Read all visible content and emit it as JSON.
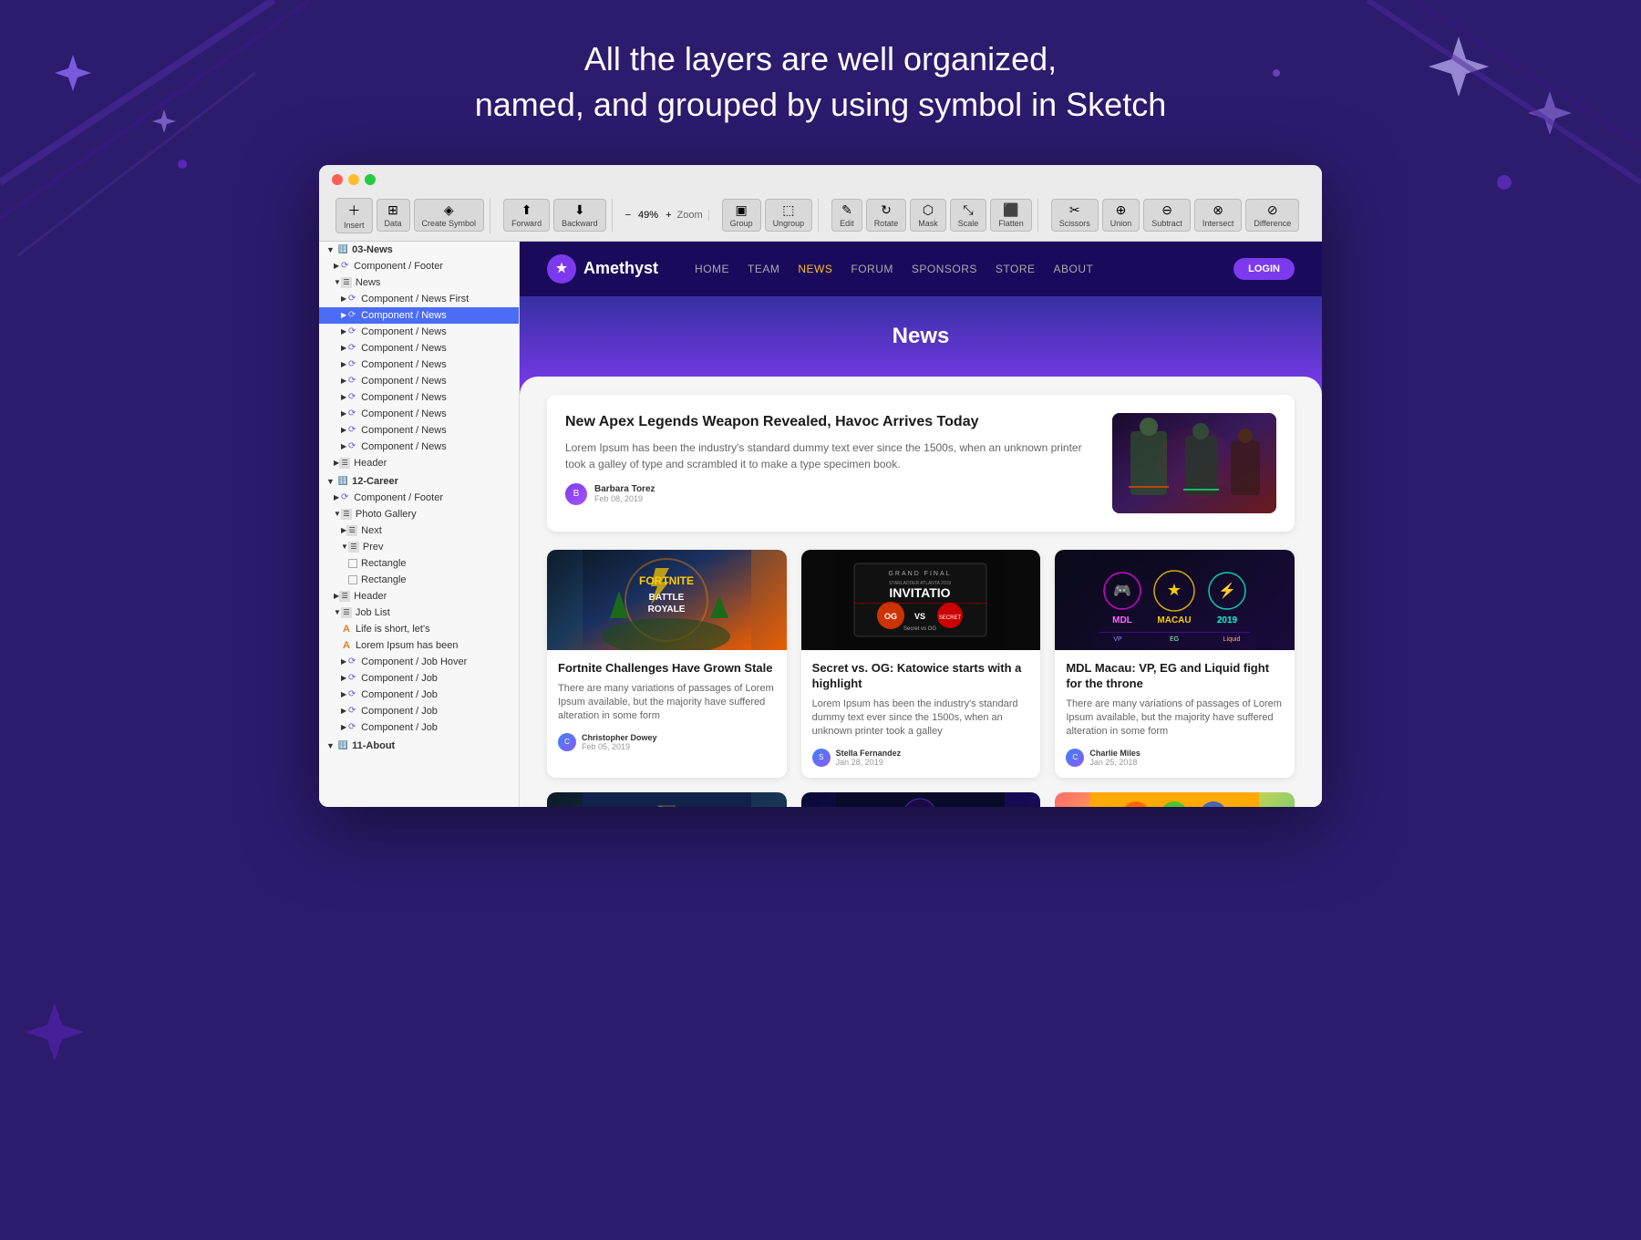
{
  "background": {
    "color": "#2d1b6e"
  },
  "hero": {
    "line1": "All the layers are well organized,",
    "line2": "named, and grouped by using symbol in Sketch"
  },
  "toolbar": {
    "buttons": [
      "Insert",
      "Data",
      "Create Symbol",
      "Forward",
      "Backward",
      "Zoom",
      "Group",
      "Ungroup",
      "Edit",
      "Rotate",
      "Mask",
      "Scale",
      "Flatten",
      "Scissors",
      "Union",
      "Subtract",
      "Intersect",
      "Difference"
    ],
    "zoom_value": "49%"
  },
  "sidebar": {
    "items": [
      {
        "id": "s1",
        "label": "03-News",
        "indent": 0,
        "type": "section",
        "expanded": true
      },
      {
        "id": "s2",
        "label": "Component / Footer",
        "indent": 1,
        "type": "symbol"
      },
      {
        "id": "s3",
        "label": "News",
        "indent": 1,
        "type": "group",
        "expanded": true
      },
      {
        "id": "s4",
        "label": "Component / News First",
        "indent": 2,
        "type": "symbol"
      },
      {
        "id": "s5",
        "label": "Component / News",
        "indent": 2,
        "type": "symbol",
        "active": true
      },
      {
        "id": "s6",
        "label": "Component / News",
        "indent": 2,
        "type": "symbol"
      },
      {
        "id": "s7",
        "label": "Component / News",
        "indent": 2,
        "type": "symbol"
      },
      {
        "id": "s8",
        "label": "Component / News",
        "indent": 2,
        "type": "symbol"
      },
      {
        "id": "s9",
        "label": "Component / News",
        "indent": 2,
        "type": "symbol"
      },
      {
        "id": "s10",
        "label": "Component / News",
        "indent": 2,
        "type": "symbol"
      },
      {
        "id": "s11",
        "label": "Component / News",
        "indent": 2,
        "type": "symbol"
      },
      {
        "id": "s12",
        "label": "Component / News",
        "indent": 2,
        "type": "symbol"
      },
      {
        "id": "s13",
        "label": "Component / News",
        "indent": 2,
        "type": "symbol"
      },
      {
        "id": "s14",
        "label": "Header",
        "indent": 1,
        "type": "group"
      },
      {
        "id": "s15",
        "label": "12-Career",
        "indent": 0,
        "type": "section",
        "expanded": true
      },
      {
        "id": "s16",
        "label": "Component / Footer",
        "indent": 1,
        "type": "symbol"
      },
      {
        "id": "s17",
        "label": "Photo Gallery",
        "indent": 1,
        "type": "group",
        "expanded": true
      },
      {
        "id": "s18",
        "label": "Next",
        "indent": 2,
        "type": "group"
      },
      {
        "id": "s19",
        "label": "Prev",
        "indent": 2,
        "type": "group"
      },
      {
        "id": "s20",
        "label": "Rectangle",
        "indent": 3,
        "type": "rect"
      },
      {
        "id": "s21",
        "label": "Rectangle",
        "indent": 3,
        "type": "rect"
      },
      {
        "id": "s22",
        "label": "Header",
        "indent": 1,
        "type": "group"
      },
      {
        "id": "s23",
        "label": "Job List",
        "indent": 1,
        "type": "group",
        "expanded": true
      },
      {
        "id": "s24",
        "label": "Life is short, let's",
        "indent": 2,
        "type": "text"
      },
      {
        "id": "s25",
        "label": "Lorem Ipsum has been",
        "indent": 2,
        "type": "text"
      },
      {
        "id": "s26",
        "label": "Component / Job Hover",
        "indent": 2,
        "type": "symbol"
      },
      {
        "id": "s27",
        "label": "Component / Job",
        "indent": 2,
        "type": "symbol"
      },
      {
        "id": "s28",
        "label": "Component / Job",
        "indent": 2,
        "type": "symbol"
      },
      {
        "id": "s29",
        "label": "Component / Job",
        "indent": 2,
        "type": "symbol"
      },
      {
        "id": "s30",
        "label": "Component / Job",
        "indent": 2,
        "type": "symbol"
      },
      {
        "id": "s31",
        "label": "11-About",
        "indent": 0,
        "type": "section",
        "expanded": true
      }
    ]
  },
  "website": {
    "logo_text": "Amethyst",
    "nav_links": [
      "HOME",
      "TEAM",
      "NEWS",
      "FORUM",
      "SPONSORS",
      "STORE",
      "ABOUT"
    ],
    "nav_active": "NEWS",
    "login_btn": "LOGIN",
    "hero_title": "News",
    "featured": {
      "title": "New Apex Legends Weapon Revealed, Havoc Arrives Today",
      "desc": "Lorem Ipsum has been the industry's standard dummy text ever since the 1500s, when an unknown printer took a galley of type and scrambled it to make a type specimen book.",
      "author": "Barbara Torez",
      "date": "Feb 08, 2019"
    },
    "articles": [
      {
        "title": "Fortnite Challenges Have Grown Stale",
        "desc": "There are many variations of passages of Lorem Ipsum available, but the majority have suffered alteration in some form",
        "author": "Christopher Dowey",
        "date": "Feb 05, 2019",
        "img_type": "fortnite"
      },
      {
        "title": "Secret vs. OG: Katowice starts with a highlight",
        "desc": "Lorem Ipsum has been the industry's standard dummy text ever since the 1500s, when an unknown printer took a galley",
        "author": "Stella Fernandez",
        "date": "Jan 28, 2019",
        "img_type": "dota"
      },
      {
        "title": "MDL Macau: VP, EG and Liquid fight for the throne",
        "desc": "There are many variations of passages of Lorem Ipsum available, but the majority have suffered alteration in some form",
        "author": "Charlie Miles",
        "date": "Jan 25, 2018",
        "img_type": "mdl"
      }
    ]
  }
}
